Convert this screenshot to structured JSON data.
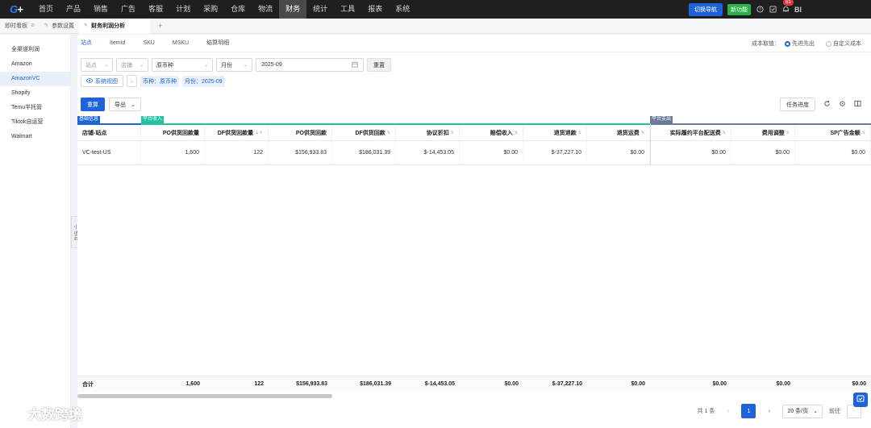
{
  "nav": {
    "logo": "G",
    "items": [
      "首页",
      "产品",
      "销售",
      "广告",
      "客服",
      "计划",
      "采购",
      "仓库",
      "物流",
      "财务",
      "统计",
      "工具",
      "报表",
      "系统"
    ],
    "active_index": 9,
    "switch_nav": "切换导航",
    "new_feature": "新功能",
    "notification_count": "61",
    "bi_label": "BI"
  },
  "tabs": {
    "items": [
      "即时看板",
      "参数设置",
      "财务利润分析"
    ],
    "active_index": 2,
    "add": "+"
  },
  "sidebar": {
    "items": [
      "全渠道利润",
      "Amazon",
      "AmazonVC",
      "Shopify",
      "Temu半托管",
      "Tiktok自运营",
      "Walmart"
    ],
    "active_index": 2,
    "collapse_label": "收起"
  },
  "subtabs": {
    "items": [
      "站点",
      "ItemId",
      "SKU",
      "MSKU",
      "结算明细"
    ],
    "active_index": 0
  },
  "cost_method": {
    "label": "成本取值：",
    "option1": "先进先出",
    "option2": "自定义成本",
    "selected": "先进先出"
  },
  "filters": {
    "site_placeholder": "站点",
    "store_placeholder": "店铺",
    "currency": "原币种",
    "period_type": "月份",
    "date_value": "2025-09",
    "reset": "重置",
    "system_view": "系统视图",
    "chip_currency": "币种：原币种",
    "chip_month": "月份：2025-09"
  },
  "actions": {
    "recalc": "重算",
    "export": "导出",
    "task_progress": "任务进度"
  },
  "groups": {
    "basic": "基础信息",
    "income": "平台收入",
    "expense": "平台支出"
  },
  "colors": {
    "primary": "#1e64d8",
    "group_basic": "#1e64d8",
    "group_income": "#22c3a1",
    "group_expense": "#6b7b99"
  },
  "table": {
    "columns": [
      "店铺-站点",
      "PO供货回款量",
      "DF供货回款量",
      "PO供货回款",
      "DF供货回款",
      "协议折扣",
      "赔偿收入",
      "退货退款",
      "退货运费",
      "实际履约平台配送费",
      "费用调整",
      "SP广告金额"
    ],
    "rows": [
      [
        "VC-test-US",
        "1,600",
        "122",
        "$156,933.83",
        "$186,031.39",
        "$-14,453.05",
        "$0.00",
        "$-37,227.10",
        "$0.00",
        "$0.00",
        "$0.00",
        "$0.00"
      ]
    ],
    "footer": [
      "合计",
      "1,600",
      "122",
      "$156,933.83",
      "$186,031.39",
      "$-14,453.05",
      "$0.00",
      "$-37,227.10",
      "$0.00",
      "$0.00",
      "$0.00",
      "$0.00"
    ]
  },
  "pagination": {
    "total": "共 1 条",
    "current": "1",
    "page_size": "20 条/页",
    "goto": "前往"
  },
  "watermark_brand": "大数跨境"
}
